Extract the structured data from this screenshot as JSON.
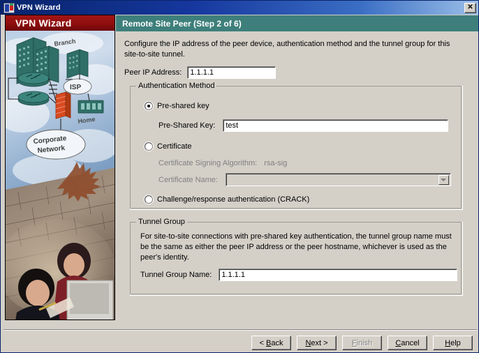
{
  "window": {
    "title": "VPN Wizard",
    "close_label": "✕"
  },
  "banner": {
    "label": "VPN Wizard"
  },
  "illustration": {
    "labels": {
      "branch": "Branch",
      "isp": "ISP",
      "home": "Home",
      "corporate_line1": "Corporate",
      "corporate_line2": "Network"
    }
  },
  "header": {
    "title": "Remote Site Peer  (Step 2 of 6)"
  },
  "main": {
    "description": "Configure the IP address of the peer device, authentication method and the tunnel group for this site-to-site tunnel.",
    "peer_ip": {
      "label": "Peer IP Address:",
      "value": "1.1.1.1"
    },
    "auth_group": {
      "title": "Authentication Method",
      "preshared": {
        "radio_label": "Pre-shared key",
        "selected": true,
        "key_label": "Pre-Shared Key:",
        "key_value": "test"
      },
      "certificate": {
        "radio_label": "Certificate",
        "selected": false,
        "algorithm_label": "Certificate Signing Algorithm:",
        "algorithm_value": "rsa-sig",
        "name_label": "Certificate Name:",
        "name_value": ""
      },
      "crack": {
        "radio_label": "Challenge/response authentication (CRACK)",
        "selected": false
      }
    },
    "tunnel_group": {
      "title": "Tunnel Group",
      "description": "For site-to-site connections with pre-shared key authentication, the tunnel group name must be the same as either the peer IP address or the peer hostname, whichever is used as the peer's identity.",
      "name_label": "Tunnel Group Name:",
      "name_value": "1.1.1.1"
    }
  },
  "buttons": {
    "back": "< Back",
    "next": "Next >",
    "finish": "Finish",
    "cancel": "Cancel",
    "help": "Help"
  },
  "colors": {
    "titlebar_start": "#08246b",
    "banner_red": "#8e0e0e",
    "header_teal": "#3e7f7b",
    "dialog_face": "#d4d0c8"
  }
}
